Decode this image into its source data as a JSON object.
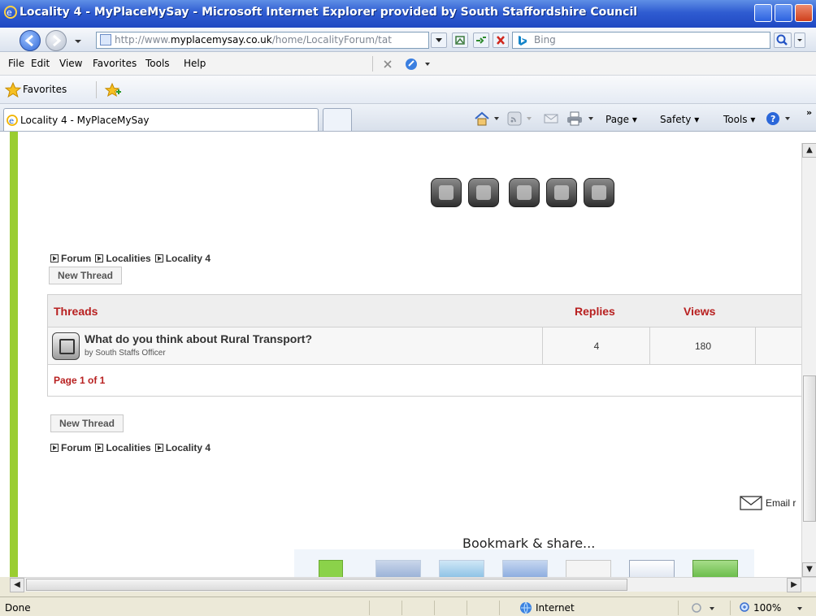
{
  "window": {
    "title": "Locality 4 - MyPlaceMySay - Microsoft Internet Explorer provided by South Staffordshire Council"
  },
  "address_bar": {
    "url_prefix": "http://www.",
    "url_domain": "myplacemysay.co.uk",
    "url_path": "/home/LocalityForum/tat",
    "search_placeholder": "Bing"
  },
  "menu": {
    "items": [
      "File",
      "Edit",
      "View",
      "Favorites",
      "Tools",
      "Help"
    ]
  },
  "favorites_bar": {
    "label": "Favorites"
  },
  "tabs": {
    "active_tab": "Locality 4 - MyPlaceMySay"
  },
  "command_bar": {
    "page": "Page",
    "safety": "Safety",
    "tools": "Tools",
    "more": "»"
  },
  "breadcrumb": {
    "items": [
      "Forum",
      "Localities",
      "Locality 4"
    ]
  },
  "forum": {
    "new_thread_label": "New Thread",
    "columns": {
      "threads": "Threads",
      "replies": "Replies",
      "views": "Views"
    },
    "rows": [
      {
        "title": "What do you think about Rural Transport?",
        "author": "by South Staffs Officer",
        "replies": "4",
        "views": "180"
      }
    ],
    "pager": "Page 1 of 1"
  },
  "footer": {
    "email_label": "Email r",
    "bookmark_heading": "Bookmark & share..."
  },
  "statusbar": {
    "status": "Done",
    "zone": "Internet",
    "zoom": "100%"
  }
}
